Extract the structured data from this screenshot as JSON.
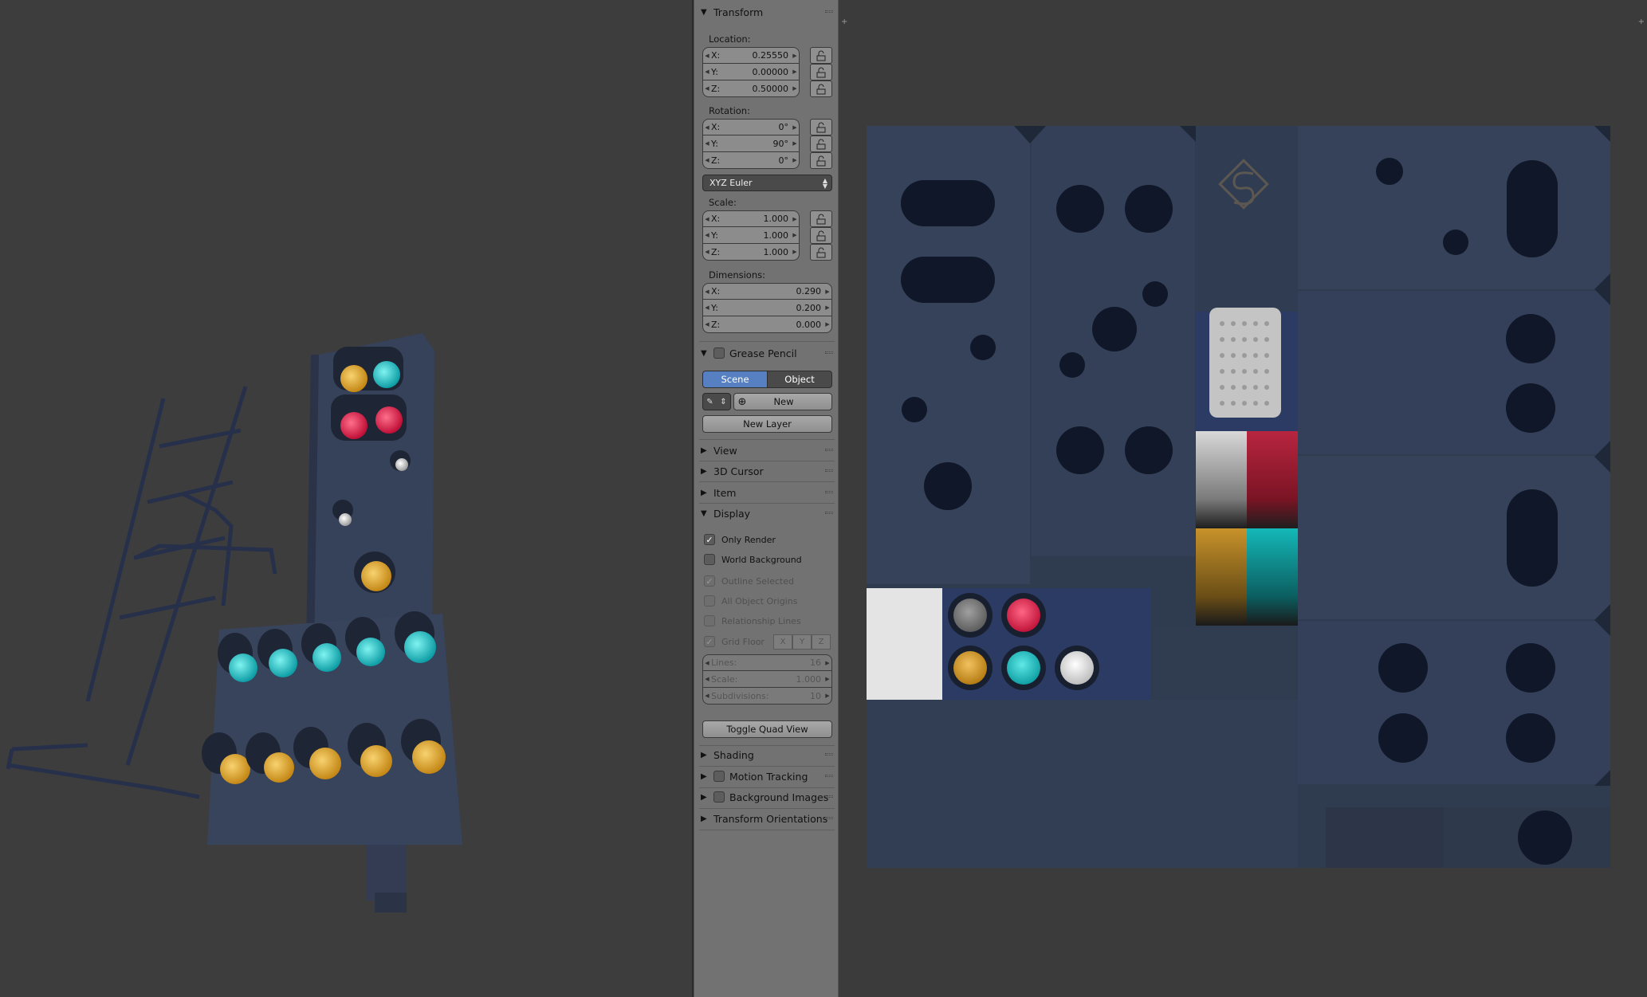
{
  "transform": {
    "header": "Transform",
    "location_label": "Location:",
    "location": [
      {
        "axis": "X:",
        "value": "0.25550"
      },
      {
        "axis": "Y:",
        "value": "0.00000"
      },
      {
        "axis": "Z:",
        "value": "0.50000"
      }
    ],
    "rotation_label": "Rotation:",
    "rotation": [
      {
        "axis": "X:",
        "value": "0°"
      },
      {
        "axis": "Y:",
        "value": "90°"
      },
      {
        "axis": "Z:",
        "value": "0°"
      }
    ],
    "rotation_mode": "XYZ Euler",
    "scale_label": "Scale:",
    "scale": [
      {
        "axis": "X:",
        "value": "1.000"
      },
      {
        "axis": "Y:",
        "value": "1.000"
      },
      {
        "axis": "Z:",
        "value": "1.000"
      }
    ],
    "dimensions_label": "Dimensions:",
    "dimensions": [
      {
        "axis": "X:",
        "value": "0.290"
      },
      {
        "axis": "Y:",
        "value": "0.200"
      },
      {
        "axis": "Z:",
        "value": "0.000"
      }
    ]
  },
  "grease_pencil": {
    "header": "Grease Pencil",
    "scene_label": "Scene",
    "object_label": "Object",
    "new_label": "New",
    "new_layer_label": "New Layer"
  },
  "collapsed_panels": {
    "view": "View",
    "cursor": "3D Cursor",
    "item": "Item"
  },
  "display": {
    "header": "Display",
    "only_render": "Only Render",
    "world_background": "World Background",
    "outline_selected": "Outline Selected",
    "all_object_origins": "All Object Origins",
    "relationship_lines": "Relationship Lines",
    "grid_floor": "Grid Floor",
    "axis_x": "X",
    "axis_y": "Y",
    "axis_z": "Z",
    "lines_label": "Lines:",
    "lines_value": "16",
    "scale_label": "Scale:",
    "scale_value": "1.000",
    "subdivisions_label": "Subdivisions:",
    "subdivisions_value": "10",
    "toggle_quad_view": "Toggle Quad View"
  },
  "bottom_panels": {
    "shading": "Shading",
    "motion_tracking": "Motion Tracking",
    "background_images": "Background Images",
    "transform_orientations": "Transform Orientations"
  },
  "colors": {
    "panel_bg": "#727272",
    "accent_blue": "#5680c2",
    "texture_base": "#2f3b4e",
    "lamp_red": "#e0234a",
    "lamp_cyan": "#19c3c8",
    "lamp_amber": "#e2a52a",
    "lamp_white": "#e6e6e6"
  }
}
